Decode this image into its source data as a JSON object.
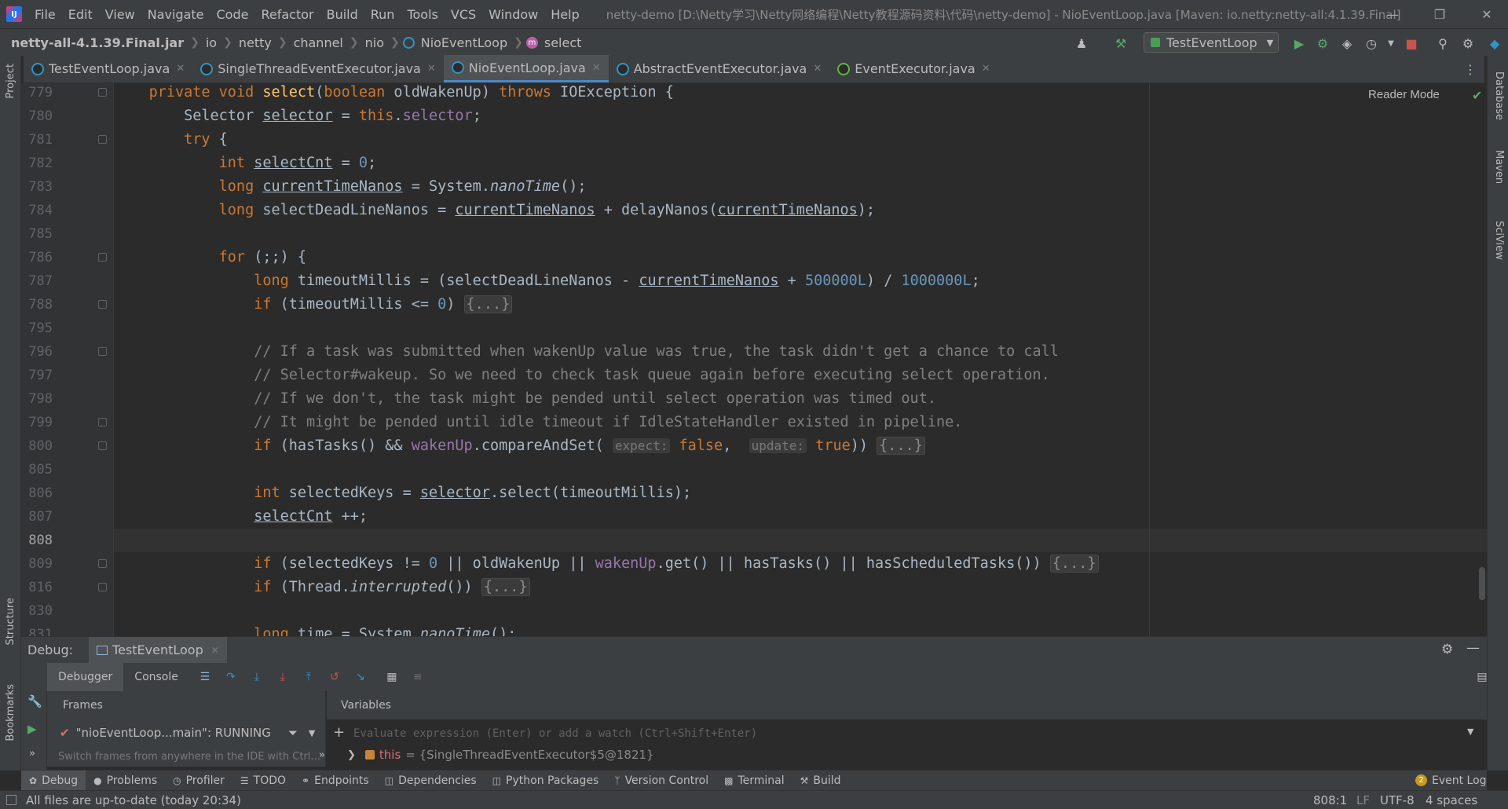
{
  "titlebar": {
    "menu": [
      "File",
      "Edit",
      "View",
      "Navigate",
      "Code",
      "Refactor",
      "Build",
      "Run",
      "Tools",
      "VCS",
      "Window",
      "Help"
    ],
    "window_title": "netty-demo [D:\\Netty学习\\Netty网络编程\\Netty教程源码资料\\代码\\netty-demo] - NioEventLoop.java [Maven: io.netty:netty-all:4.1.39.Final]"
  },
  "breadcrumb": {
    "items": [
      "netty-all-4.1.39.Final.jar",
      "io",
      "netty",
      "channel",
      "nio",
      "NioEventLoop",
      "select"
    ]
  },
  "run_config": {
    "label": "TestEventLoop"
  },
  "tabs": [
    {
      "label": "TestEventLoop.java",
      "active": false
    },
    {
      "label": "SingleThreadEventExecutor.java",
      "active": false
    },
    {
      "label": "NioEventLoop.java",
      "active": true
    },
    {
      "label": "AbstractEventExecutor.java",
      "active": false
    },
    {
      "label": "EventExecutor.java",
      "active": false
    }
  ],
  "left_strip": {
    "project": "Project",
    "structure": "Structure",
    "bookmarks": "Bookmarks"
  },
  "right_strip": {
    "database": "Database",
    "maven": "Maven",
    "sciview": "SciView"
  },
  "editor": {
    "reader_mode": "Reader Mode",
    "current_line": "808",
    "line_numbers": [
      "779",
      "780",
      "781",
      "782",
      "783",
      "784",
      "785",
      "786",
      "787",
      "788",
      "795",
      "796",
      "797",
      "798",
      "799",
      "800",
      "805",
      "806",
      "807",
      "808",
      "809",
      "816",
      "830",
      "831"
    ]
  },
  "debug": {
    "label": "Debug:",
    "session": "TestEventLoop",
    "tabs": [
      "Debugger",
      "Console"
    ],
    "frames_header": "Frames",
    "variables_header": "Variables",
    "thread": "\"nioEventLoop...main\": RUNNING",
    "frames_hint": "Switch frames from anywhere in the IDE with Ctrl...",
    "eval_placeholder": "Evaluate expression (Enter) or add a watch (Ctrl+Shift+Enter)",
    "var_name": "this",
    "var_value": "= {SingleThreadEventExecutor$5@1821}"
  },
  "toolwindows": [
    "Debug",
    "Problems",
    "Profiler",
    "TODO",
    "Endpoints",
    "Dependencies",
    "Python Packages",
    "Version Control",
    "Terminal",
    "Build"
  ],
  "event_log": {
    "count": "2",
    "label": "Event Log"
  },
  "status": {
    "message": "All files are up-to-date (today 20:34)",
    "position": "808:1",
    "line_sep": "LF",
    "encoding": "UTF-8",
    "indent": "4 spaces"
  },
  "colors": {
    "keyword": "#cc7832",
    "number": "#6897bb",
    "comment": "#808080",
    "field": "#9876aa",
    "text": "#a9b7c6",
    "accent": "#4a88c7"
  }
}
